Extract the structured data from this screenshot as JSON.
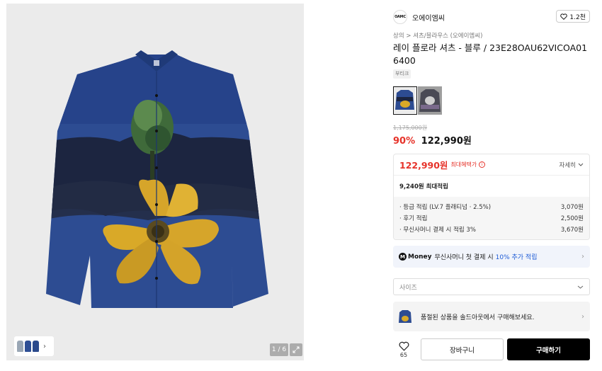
{
  "gallery": {
    "counter": "1 / 6",
    "main_image": "floral-print-blue-shirt",
    "expand_icon": "expand-icon",
    "thumbnail_strip_icon": "chevron-right-icon"
  },
  "brand": {
    "logo_text": "OAMC",
    "name": "오에이엠씨",
    "like_count": "1.2천"
  },
  "breadcrumb": {
    "category": "상의",
    "separator": ">",
    "subcategory": "셔츠/블라우스 (오에이엠씨)"
  },
  "product": {
    "title": "레이 플로라 셔츠 - 블루 / 23E28OAU62VICOA016400",
    "tag": "부티크",
    "original_price": "1,175,000원",
    "discount_rate": "90%",
    "sale_price": "122,990원"
  },
  "benefit": {
    "max_price": "122,990원",
    "max_label": "최대혜택가",
    "detail_label": "자세히",
    "points_total": "9,240원 최대적립",
    "items": [
      {
        "label": "· 등급 적립 (LV.7 플래티넘 · 2.5%)",
        "value": "3,070원"
      },
      {
        "label": "· 후기 적립",
        "value": "2,500원"
      },
      {
        "label": "· 무신사머니 결제 시 적립 3%",
        "value": "3,670원"
      }
    ]
  },
  "money_banner": {
    "badge": "M",
    "brand": "Money",
    "text": "무신사머니 첫 결제 시",
    "accent": "10% 추가 적립"
  },
  "size_select": {
    "placeholder": "사이즈"
  },
  "soldout_banner": {
    "text": "품절된 상품을 솔드아웃에서 구매해보세요."
  },
  "bottom": {
    "wish_count": "65",
    "cart_label": "장바구니",
    "buy_label": "구매하기"
  },
  "colors": {
    "accent_red": "#e6332a",
    "accent_blue": "#1e5bd6",
    "shirt_blue": "#2b4a8c",
    "flower_yellow": "#d9a928"
  }
}
